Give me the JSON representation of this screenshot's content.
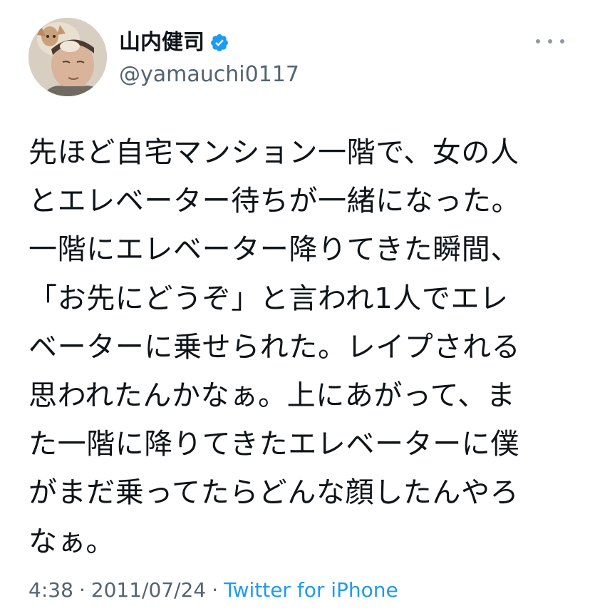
{
  "tweet": {
    "author": {
      "display_name": "山内健司",
      "handle": "@yamauchi0117",
      "verified": true,
      "avatar_icon": "profile-photo"
    },
    "more_icon": "more-horizontal-icon",
    "text": "先ほど自宅マンション一階で、女の人\nとエレベーター待ちが一緒になった。\n一階にエレベーター降りてきた瞬間、\n「お先にどうぞ」と言われ1人でエレ\nベーターに乗せられた。レイプされる\n思われたんかなぁ。上にあがって、ま\nた一階に降りてきたエレベーターに僕\nがまだ乗ってたらどんな顔したんやろ\nなぁ。",
    "time": "4:38",
    "separator": "·",
    "date": "2011/07/24",
    "source": "Twitter for iPhone"
  },
  "colors": {
    "text": "#0f1419",
    "secondary": "#536471",
    "link": "#1d9bf0",
    "verified_badge": "#1d9bf0"
  }
}
